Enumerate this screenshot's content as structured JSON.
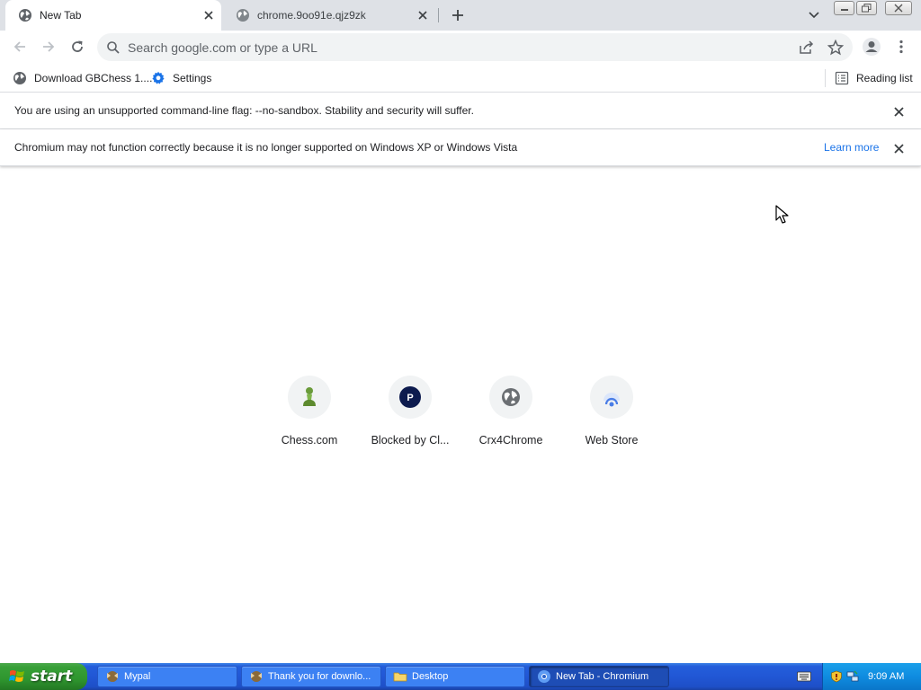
{
  "tabs": [
    {
      "title": "New Tab",
      "active": true,
      "icon": "globe-icon"
    },
    {
      "title": "chrome.9oo91e.qjz9zk",
      "active": false,
      "icon": "globe-icon"
    }
  ],
  "omnibox": {
    "placeholder": "Search google.com or type a URL",
    "value": ""
  },
  "bookmarks": {
    "items": [
      {
        "label": "Download GBChess 1....",
        "icon": "globe-icon"
      },
      {
        "label": "Settings",
        "icon": "gear-icon"
      }
    ],
    "reading_list": "Reading list"
  },
  "infobars": [
    {
      "message": "You are using an unsupported command-line flag: --no-sandbox. Stability and security will suffer."
    },
    {
      "message": "Chromium may not function correctly because it is no longer supported on Windows XP or Windows Vista",
      "link": "Learn more"
    }
  ],
  "shortcuts": [
    {
      "label": "Chess.com",
      "icon": "chess-pawn-icon"
    },
    {
      "label": "Blocked by Cl...",
      "icon": "p-letter-icon"
    },
    {
      "label": "Crx4Chrome",
      "icon": "globe-icon"
    },
    {
      "label": "Web Store",
      "icon": "web-store-icon"
    }
  ],
  "taskbar": {
    "start_label": "start",
    "tasks": [
      {
        "label": "Mypal",
        "active": false
      },
      {
        "label": "Thank you for downlo...",
        "active": false
      },
      {
        "label": "Desktop",
        "active": false
      },
      {
        "label": "New Tab - Chromium",
        "active": true
      }
    ],
    "clock": "9:09 AM"
  },
  "colors": {
    "tabstrip": "#dee1e6",
    "link": "#1a73e8",
    "taskbar": "#245edb",
    "start": "#38a038",
    "tray": "#0f8ce0"
  }
}
